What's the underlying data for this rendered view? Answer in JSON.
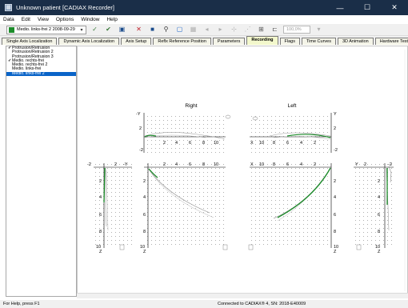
{
  "window": {
    "title": "Unknown patient [CADIAX Recorder]"
  },
  "menu": [
    "Data",
    "Edit",
    "View",
    "Options",
    "Window",
    "Help"
  ],
  "toolbar": {
    "combo_value": "Medio. links-frei 2 2008-09-29",
    "zoom": "100,0%"
  },
  "tabs": [
    {
      "label": "Single Axis Localization"
    },
    {
      "label": "Dynamic Axis Localization"
    },
    {
      "label": "Axis Setup"
    },
    {
      "label": "Reflx Reference Position"
    },
    {
      "label": "Parameters"
    },
    {
      "label": "Recording",
      "active": true
    },
    {
      "label": "Flags"
    },
    {
      "label": "Time Curves"
    },
    {
      "label": "3D Animation"
    },
    {
      "label": "Hardware Test"
    }
  ],
  "sidebar": {
    "items": [
      {
        "label": "Protrusion/Retrusion",
        "checked": true
      },
      {
        "label": "Protrusion/Retrusion 2"
      },
      {
        "label": "Protrusion/Retrusion 3"
      },
      {
        "label": "Medio. rechts-frei",
        "checked": true
      },
      {
        "label": "Medio. rechts-frei 2"
      },
      {
        "label": "Medio. links-frei"
      },
      {
        "label": "Medio. links-frei 2",
        "selected": true
      }
    ]
  },
  "plots": {
    "right_title": "Right",
    "left_title": "Left",
    "ticks_pos": [
      "2",
      "4",
      "6",
      "8",
      "10"
    ],
    "ticks_pos_rev": [
      "10",
      "8",
      "6",
      "4",
      "2"
    ],
    "neg2": "-2",
    "two": "2",
    "y_axis": "Y",
    "neg_y_axis": "-Y",
    "x_axis": "X",
    "z_axis": "Z"
  },
  "status": {
    "help": "For Help, press F1",
    "connection": "Connected to CADIAX® 4, SN: 2018-E40009"
  },
  "colors": {
    "title_bg": "#1a2e48",
    "selected": "#0a64c8",
    "trace_green": "#1c8c2a",
    "trace_gray": "#a0a0a0"
  }
}
